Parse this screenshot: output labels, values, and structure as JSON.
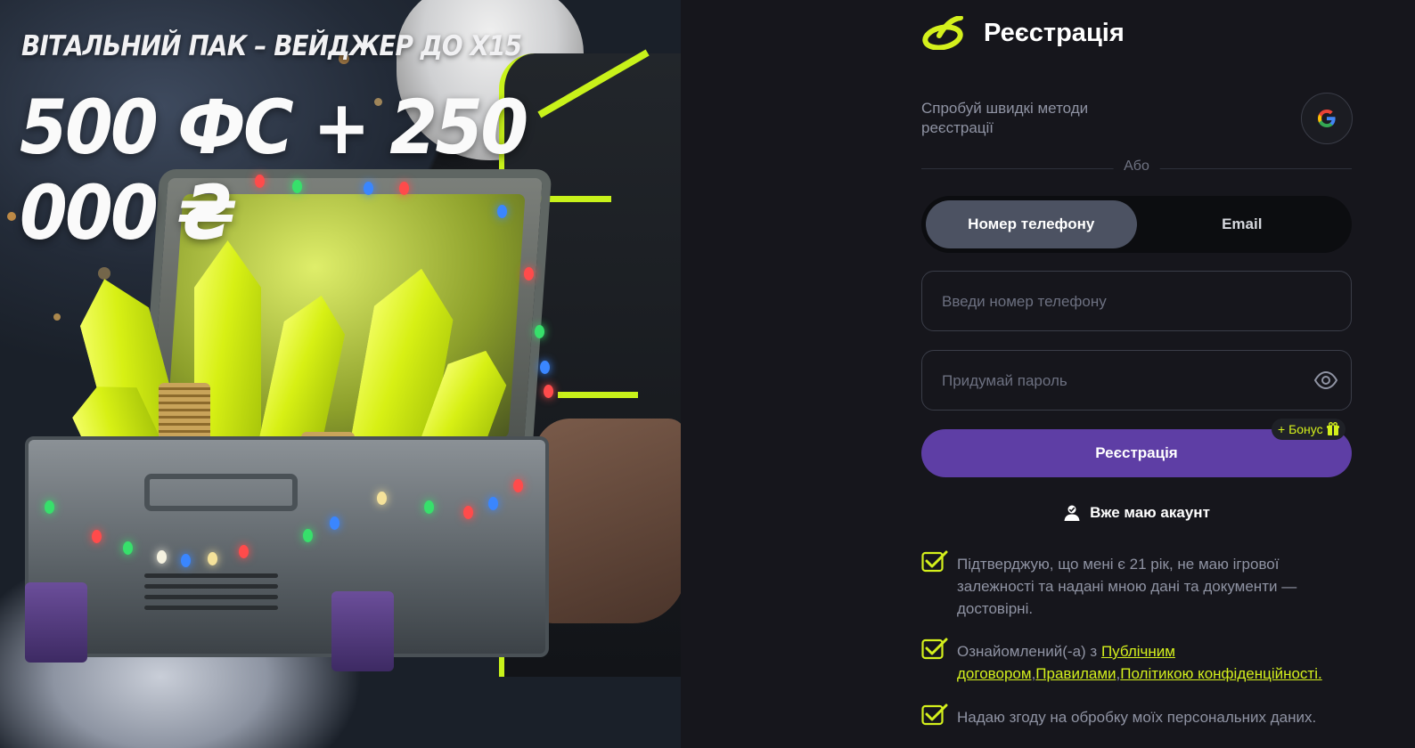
{
  "promo": {
    "subtitle": "ВІТАЛЬНИЙ ПАК – ВЕЙДЖЕР ДО X15",
    "amount": "500 ФС + 250 000 ₴"
  },
  "header": {
    "title": "Реєстрація"
  },
  "quick_methods": {
    "text": "Спробуй швидкі методи реєстрації",
    "google_icon": "google-icon"
  },
  "divider_label": "Або",
  "tabs": [
    {
      "label": "Номер телефону",
      "active": true
    },
    {
      "label": "Email",
      "active": false
    }
  ],
  "phone_field": {
    "placeholder": "Введи номер телефону",
    "value": ""
  },
  "password_field": {
    "placeholder": "Придумай пароль",
    "value": "",
    "toggle_icon": "eye-icon"
  },
  "submit": {
    "label": "Реєстрація",
    "bonus_label": "+ Бонус",
    "bonus_icon": "gift-icon"
  },
  "login_link": {
    "label": "Вже маю акаунт",
    "icon": "user-icon"
  },
  "consents": [
    {
      "text": "Підтверджую, що мені є 21 рік, не маю ігрової залежності та надані мною дані та документи — достовірні.",
      "checked": true
    },
    {
      "text_prefix": "Ознайомлений(-а) з ",
      "links": [
        "Публічним договором",
        "Правилами",
        "Політикою конфіденційності."
      ],
      "checked": true
    },
    {
      "text": "Надаю згоду на обробку моїх персональних даних.",
      "checked": true
    }
  ],
  "colors": {
    "background": "#16161c",
    "accent_lime": "#d4f01c",
    "primary_button": "#5e3ea5",
    "active_tab": "#4c5262",
    "muted_text": "#8f93a3"
  }
}
